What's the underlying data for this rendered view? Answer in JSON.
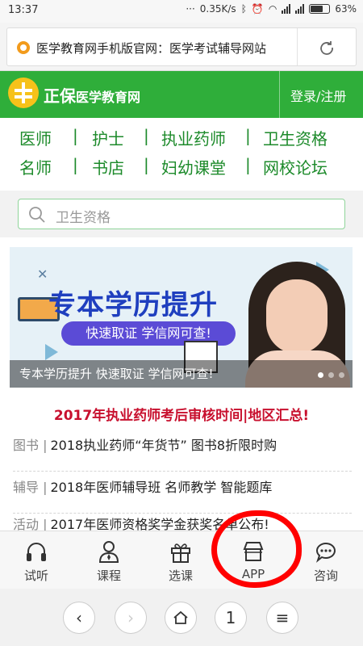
{
  "status_bar": {
    "time": "13:37",
    "speed": "0.35K/s",
    "battery": "63%"
  },
  "browser": {
    "page_title": "医学教育网手机版官网：医学考试辅导网站"
  },
  "header": {
    "logo_main": "正保",
    "logo_sub": "医学教育网",
    "login": "登录/注册",
    "brand_color": "#2fae3a"
  },
  "categories": {
    "row1": [
      "医师",
      "护士",
      "执业药师",
      "卫生资格"
    ],
    "row2": [
      "名师",
      "书店",
      "妇幼课堂",
      "网校论坛"
    ],
    "separator": "|"
  },
  "search": {
    "placeholder": "卫生资格"
  },
  "banner": {
    "headline": "专本学历提升",
    "pill": "快速取证 学信网可查!",
    "caption": "专本学历提升 快速取证 学信网可查!",
    "slide_count": 3,
    "active_slide": 1
  },
  "top_news": "2017年执业药师考后审核时间|地区汇总!",
  "news": [
    {
      "tag": "图书",
      "text": "2018执业药师“年货节” 图书8折限时购"
    },
    {
      "tag": "辅导",
      "text": "2018年医师辅导班 名师教学 智能题库"
    },
    {
      "tag": "活动",
      "text": "2017年医师资格奖学金获奖名单公布!"
    }
  ],
  "tabbar": [
    {
      "label": "试听",
      "icon": "headphones-icon"
    },
    {
      "label": "课程",
      "icon": "teacher-icon"
    },
    {
      "label": "选课",
      "icon": "gift-box-icon"
    },
    {
      "label": "APP",
      "icon": "store-icon"
    },
    {
      "label": "咨询",
      "icon": "chat-bubble-icon"
    }
  ],
  "browser_nav": {
    "back": "‹",
    "forward": "›",
    "tabs_count": "1",
    "menu": "≡"
  }
}
